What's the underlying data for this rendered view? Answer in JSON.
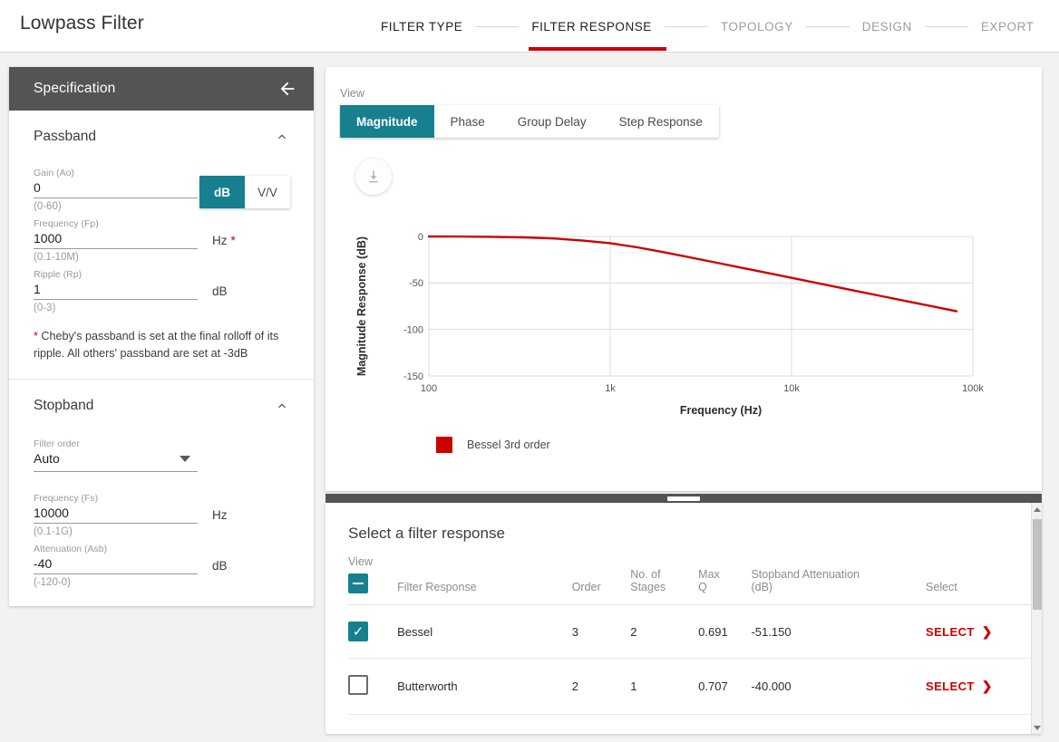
{
  "header": {
    "title": "Lowpass Filter",
    "steps": [
      {
        "label": "FILTER TYPE",
        "state": "done"
      },
      {
        "label": "FILTER RESPONSE",
        "state": "active"
      },
      {
        "label": "TOPOLOGY",
        "state": "upcoming"
      },
      {
        "label": "DESIGN",
        "state": "upcoming"
      },
      {
        "label": "EXPORT",
        "state": "upcoming"
      }
    ],
    "accent_color": "#cc0000"
  },
  "spec": {
    "title": "Specification",
    "passband": {
      "title": "Passband",
      "gain": {
        "label": "Gain (Ao)",
        "value": "0",
        "hint": "(0-60)",
        "unit_options": [
          "dB",
          "V/V"
        ],
        "unit_selected": "dB"
      },
      "frequency": {
        "label": "Frequency (Fp)",
        "value": "1000",
        "unit": "Hz",
        "required_marker": "*",
        "hint": "(0.1-10M)"
      },
      "ripple": {
        "label": "Ripple (Rp)",
        "value": "1",
        "unit": "dB",
        "hint": "(0-3)"
      },
      "note_star": "*",
      "note": " Cheby's passband is set at the final rolloff of its ripple. All others' passband are set at -3dB"
    },
    "stopband": {
      "title": "Stopband",
      "filter_order": {
        "label": "Filter order",
        "value": "Auto"
      },
      "frequency": {
        "label": "Frequency (Fs)",
        "value": "10000",
        "unit": "Hz",
        "hint": "(0.1-1G)"
      },
      "attenuation": {
        "label": "Attenuation (Asb)",
        "value": "-40",
        "unit": "dB",
        "hint": "(-120-0)"
      }
    }
  },
  "chart_panel": {
    "view_label": "View",
    "tabs": [
      {
        "label": "Magnitude",
        "active": true
      },
      {
        "label": "Phase",
        "active": false
      },
      {
        "label": "Group Delay",
        "active": false
      },
      {
        "label": "Step Response",
        "active": false
      }
    ],
    "download_icon": "download-icon"
  },
  "chart_data": {
    "type": "line",
    "title": "",
    "xlabel": "Frequency (Hz)",
    "ylabel": "Magnitude Response (dB)",
    "xscale": "log",
    "xlim": [
      100,
      100000
    ],
    "ylim": [
      -150,
      0
    ],
    "xticks": [
      100,
      1000,
      10000,
      100000
    ],
    "xtick_labels": [
      "100",
      "1k",
      "10k",
      "100k"
    ],
    "yticks": [
      0,
      -50,
      -100,
      -150
    ],
    "ytick_labels": [
      "0",
      "-50",
      "-100",
      "-150"
    ],
    "grid": true,
    "legend_position": "bottom-left",
    "series": [
      {
        "name": "Bessel 3rd order",
        "color": "#cc0000",
        "x": [
          100,
          150,
          220,
          330,
          470,
          680,
          1000,
          1500,
          2200,
          3300,
          4700,
          6800,
          10000,
          15000,
          22000,
          33000,
          47000,
          68000,
          85000
        ],
        "values": [
          0,
          0,
          -0.1,
          -0.3,
          -0.7,
          -1.6,
          -3.3,
          -7.0,
          -12.2,
          -18.4,
          -24.2,
          -30.4,
          -36.5,
          -42.6,
          -47.9,
          -53.2,
          -57.9,
          -62.9,
          -65.6
        ]
      }
    ]
  },
  "chart_legend": [
    {
      "label": "Bessel 3rd order",
      "color": "#cc0000"
    }
  ],
  "table_panel": {
    "title": "Select a filter response",
    "columns": [
      {
        "key": "view",
        "label": "View"
      },
      {
        "key": "name",
        "label": "Filter Response"
      },
      {
        "key": "order",
        "label": "Order"
      },
      {
        "key": "stages",
        "label": "No. of Stages"
      },
      {
        "key": "maxq",
        "label": "Max Q"
      },
      {
        "key": "atten",
        "label": "Stopband Attenuation (dB)"
      },
      {
        "key": "select",
        "label": "Select"
      }
    ],
    "header_checkbox_state": "indeterminate",
    "rows": [
      {
        "checked": true,
        "name": "Bessel",
        "order": "3",
        "stages": "2",
        "maxq": "0.691",
        "atten": "-51.150",
        "select_label": "SELECT"
      },
      {
        "checked": false,
        "name": "Butterworth",
        "order": "2",
        "stages": "1",
        "maxq": "0.707",
        "atten": "-40.000",
        "select_label": "SELECT"
      }
    ]
  },
  "colors": {
    "teal": "#17808f",
    "red": "#cc0000",
    "dark_header": "#545454"
  }
}
